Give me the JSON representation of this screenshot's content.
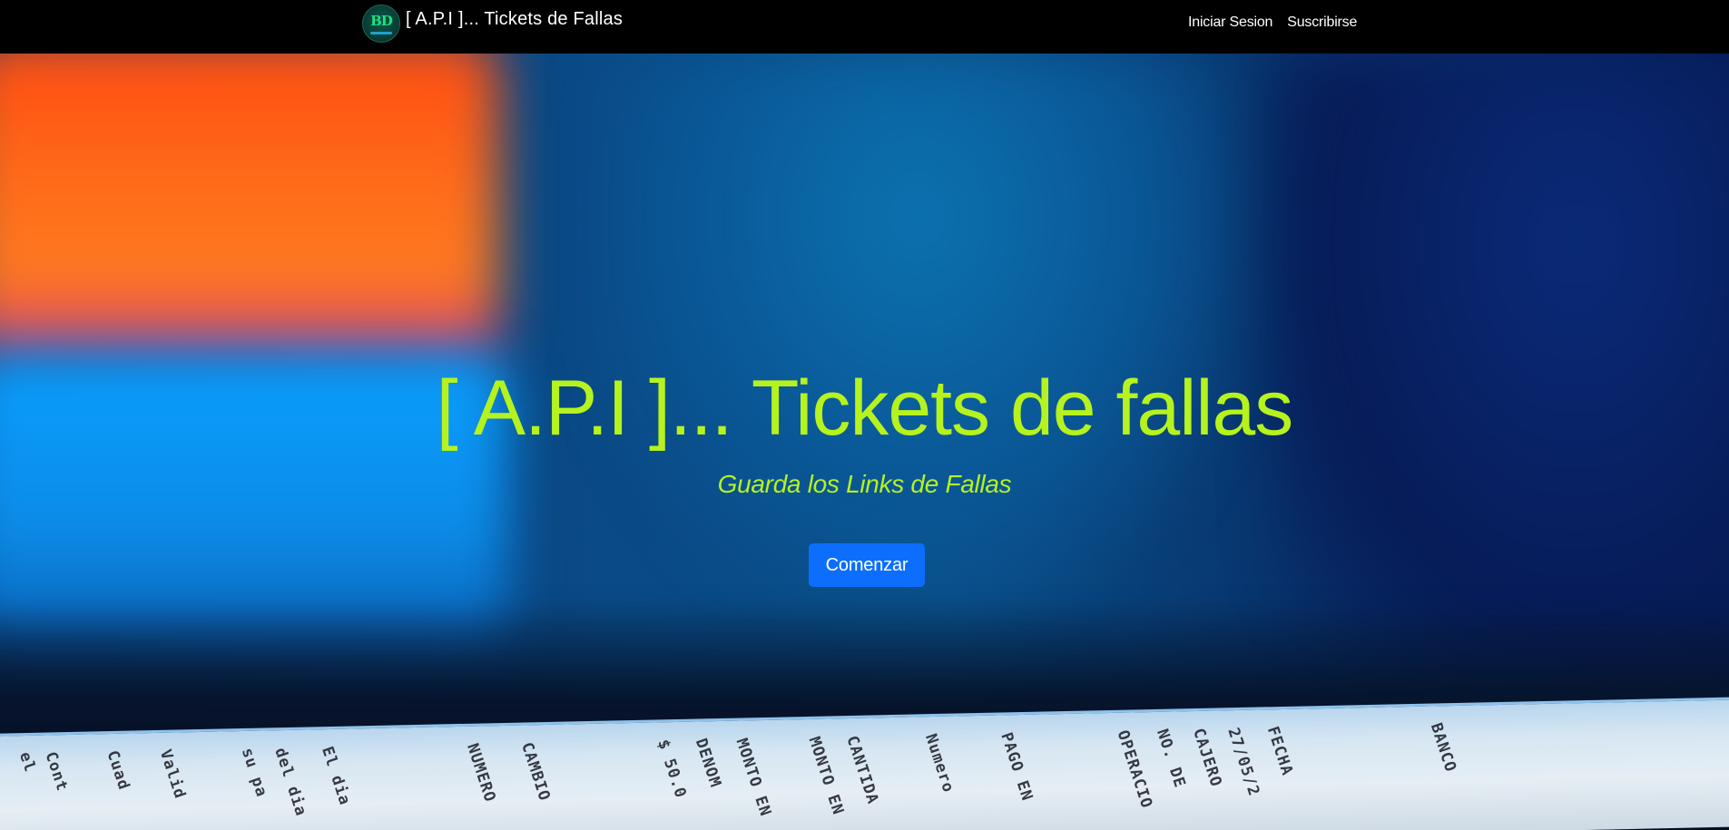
{
  "navbar": {
    "logo_text": "BD",
    "brand_title": "[ A.P.I ]... Tickets de Fallas",
    "links": [
      {
        "label": "Iniciar Sesion"
      },
      {
        "label": "Suscribirse"
      }
    ]
  },
  "hero": {
    "title": "[ A.P.I ]... Tickets de fallas",
    "subtitle": "Guarda los Links de Fallas",
    "cta_label": "Comenzar",
    "receipt_text": [
      "el",
      "Cont",
      "Cuad",
      "Valid",
      "su pa",
      "del dia",
      "El dia",
      "NUMERO",
      "CAMBIO",
      "$ 50.0",
      "DENOM",
      "MONTO EN",
      "MONTO EN",
      "CANTIDA",
      "Numero",
      "PAGO EN",
      "OPERACIO",
      "NO. DE",
      "CAJERO",
      "27/05/2",
      "FECHA",
      "BANCO"
    ]
  },
  "colors": {
    "accent": "#b6f21e",
    "button": "#0d6efd",
    "navbar_bg": "#000000"
  }
}
